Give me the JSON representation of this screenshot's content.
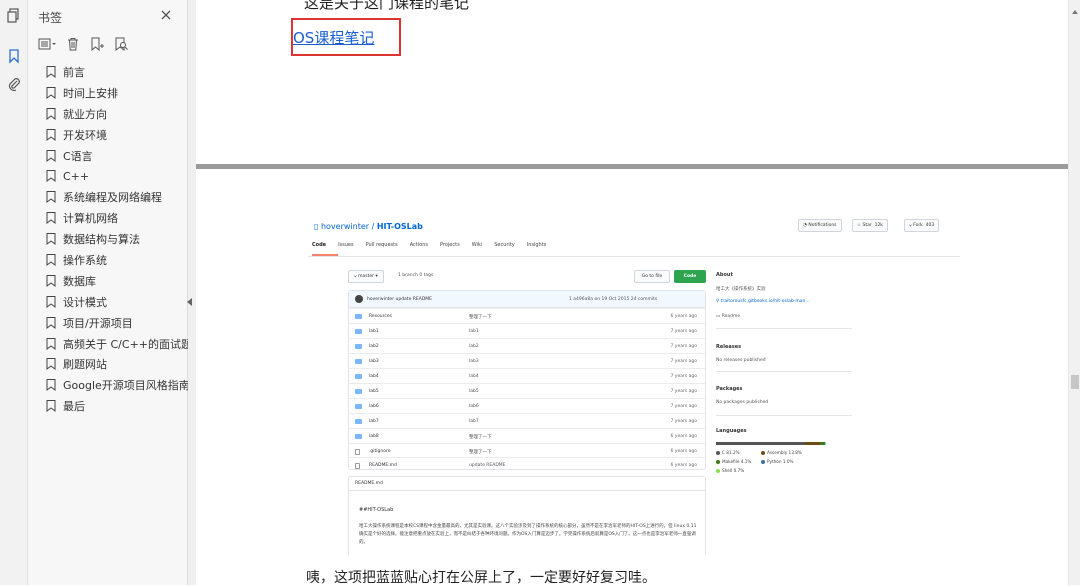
{
  "bookmark_panel": {
    "title": "书签",
    "items": [
      {
        "label": "前言"
      },
      {
        "label": "时间上安排"
      },
      {
        "label": "就业方向"
      },
      {
        "label": "开发环境"
      },
      {
        "label": "C语言"
      },
      {
        "label": "C++"
      },
      {
        "label": "系统编程及网络编程"
      },
      {
        "label": "计算机网络"
      },
      {
        "label": "数据结构与算法"
      },
      {
        "label": "操作系统"
      },
      {
        "label": "数据库"
      },
      {
        "label": "设计模式"
      },
      {
        "label": "项目/开源项目"
      },
      {
        "label": "高频关于 C/C++的面试题"
      },
      {
        "label": "刷题网站"
      },
      {
        "label": "Google开源项目风格指南"
      },
      {
        "label": "最后"
      }
    ]
  },
  "document": {
    "cut_line": "这是关于这门课程的笔记",
    "link_text": "OS课程笔记",
    "bottom_text": "咦，这项把蓝蓝贴心打在公屏上了，一定要好好复习哇。"
  },
  "github": {
    "owner": "hoverwinter",
    "repo": "HIT-OSLab",
    "notifications": "Notifications",
    "star": "Star",
    "star_count": "12k",
    "fork": "Fork",
    "fork_count": "403",
    "tabs": [
      "Code",
      "Issues",
      "Pull requests",
      "Actions",
      "Projects",
      "Wiki",
      "Security",
      "Insights"
    ],
    "branch": "master",
    "branch_meta": "1 branch   0 tags",
    "go_to_file": "Go to file",
    "code_button": "Code",
    "commit": {
      "author_msg": "hoverwinter update README",
      "meta": "1   a496a8a on 19 Oct 2015   24 commits"
    },
    "files": [
      {
        "name": "Resources",
        "msg": "整理了一下",
        "age": "6 years ago",
        "type": "dir"
      },
      {
        "name": "lab1",
        "msg": "lab1",
        "age": "7 years ago",
        "type": "dir"
      },
      {
        "name": "lab2",
        "msg": "lab2",
        "age": "7 years ago",
        "type": "dir"
      },
      {
        "name": "lab3",
        "msg": "lab3",
        "age": "7 years ago",
        "type": "dir"
      },
      {
        "name": "lab4",
        "msg": "lab4",
        "age": "7 years ago",
        "type": "dir"
      },
      {
        "name": "lab5",
        "msg": "lab5",
        "age": "7 years ago",
        "type": "dir"
      },
      {
        "name": "lab6",
        "msg": "lab6",
        "age": "7 years ago",
        "type": "dir"
      },
      {
        "name": "lab7",
        "msg": "lab7",
        "age": "7 years ago",
        "type": "dir"
      },
      {
        "name": "lab8",
        "msg": "整理了一下",
        "age": "6 years ago",
        "type": "dir"
      },
      {
        "name": ".gitignore",
        "msg": "整理了一下",
        "age": "6 years ago",
        "type": "file"
      },
      {
        "name": "README.md",
        "msg": "update README",
        "age": "6 years ago",
        "type": "file"
      }
    ],
    "readme_header": "README.md",
    "readme_title": "##HIT-OSLab",
    "readme_body": "哈工大操作系统课程是本校CS课程中含金量最高的，尤其是实验课。这八个实验涉及到了操作系统的核心部分，虽然不是在李治军老师的HIT-OS上进行的，但 linux 0.11 确实是个好的选择。能注意把重点放在实验上，而不是纠结于各种环境问题。作为OS入门算是迈步了。学完操作系统后就算是OS入门了。这一点也是李治军老师一直强调的。",
    "about": {
      "heading": "About",
      "desc": "哈工大《操作系统》实验",
      "link": "traitorousfc.gitbooks.io/hit-oslab-man...",
      "readme": "Readme"
    },
    "releases": {
      "heading": "Releases",
      "text": "No releases published"
    },
    "packages": {
      "heading": "Packages",
      "text": "No packages published"
    },
    "languages": {
      "heading": "Languages",
      "items": [
        {
          "name": "C",
          "pct": "81.2%",
          "value": 81.2,
          "color": "#555555"
        },
        {
          "name": "Assembly",
          "pct": "13.8%",
          "value": 13.8,
          "color": "#6E4C13"
        },
        {
          "name": "Makefile",
          "pct": "4.1%",
          "value": 4.1,
          "color": "#427819"
        },
        {
          "name": "Python",
          "pct": "1.0%",
          "value": 1.0,
          "color": "#3572A5"
        },
        {
          "name": "Shell",
          "pct": "0.7%",
          "value": 0.7,
          "color": "#89e051"
        }
      ]
    }
  }
}
